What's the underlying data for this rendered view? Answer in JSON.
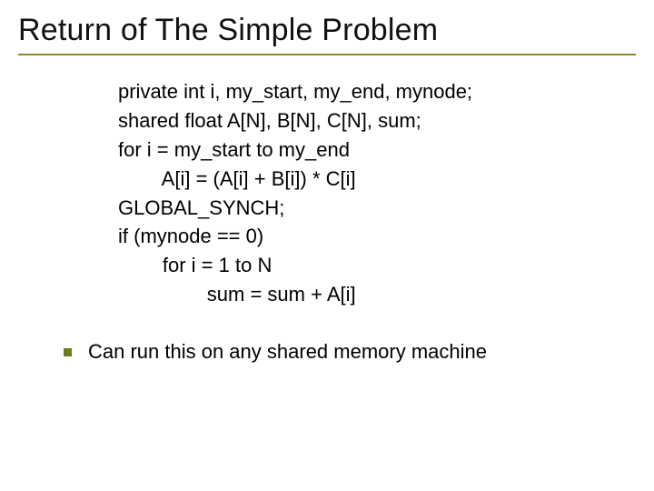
{
  "title": "Return of The Simple Problem",
  "code": {
    "l1": "private int i, my_start, my_end, mynode;",
    "l2": "shared float A[N], B[N], C[N], sum;",
    "l3": "for i = my_start to my_end",
    "l4": "        A[i] = (A[i] + B[i]) * C[i]",
    "l5": "GLOBAL_SYNCH;",
    "l6": "if (mynode == 0)",
    "l7": "        for i = 1 to N",
    "l8": "                sum = sum + A[i]"
  },
  "bullet": "Can run this on any shared memory machine"
}
